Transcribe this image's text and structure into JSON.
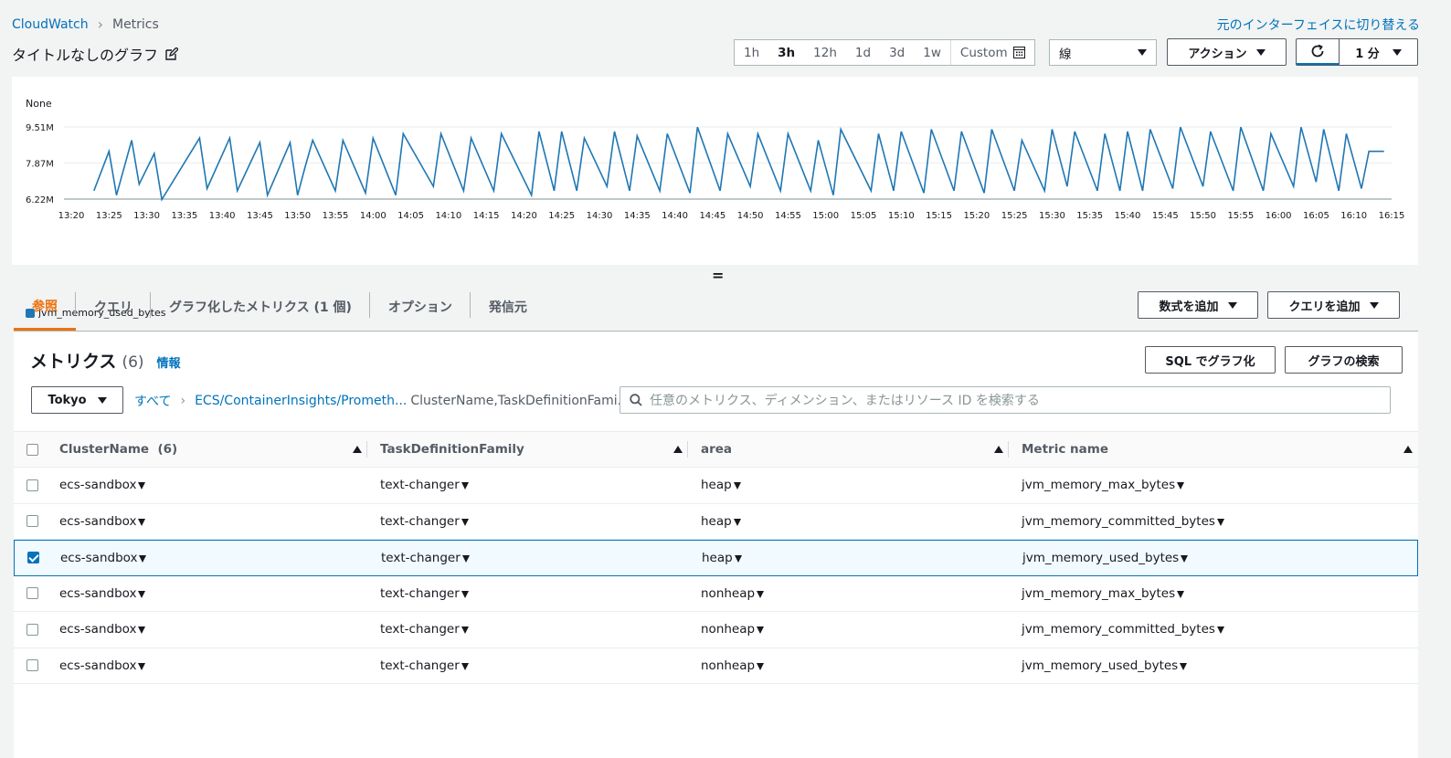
{
  "breadcrumb": {
    "root": "CloudWatch",
    "current": "Metrics"
  },
  "classic_link": "元のインターフェイスに切り替える",
  "graph_title": "タイトルなしのグラフ",
  "time_range": {
    "options": [
      "1h",
      "3h",
      "12h",
      "1d",
      "3d",
      "1w"
    ],
    "selected": "3h",
    "custom_label": "Custom"
  },
  "chart_type": "線",
  "actions_label": "アクション",
  "refresh_interval": "1 分",
  "tabs": [
    "参照",
    "クエリ",
    "グラフ化したメトリクス (1 個)",
    "オプション",
    "発信元"
  ],
  "active_tab": "参照",
  "add_math_label": "数式を追加",
  "add_query_label": "クエリを追加",
  "metrics": {
    "title": "メトリクス",
    "count": "(6)",
    "info": "情報",
    "sql_label": "SQL でグラフ化",
    "search_graph_label": "グラフの検索",
    "region": "Tokyo",
    "crumb_all": "すべて",
    "crumb_namespace": "ECS/ContainerInsights/Prometh...",
    "crumb_dimensions": "ClusterName,TaskDefinitionFami...",
    "search_placeholder": "任意のメトリクス、ディメンション、またはリソース ID を検索する"
  },
  "table": {
    "headers": [
      "ClusterName  (6)",
      "TaskDefinitionFamily",
      "area",
      "Metric name"
    ],
    "rows": [
      {
        "cluster": "ecs-sandbox",
        "task": "text-changer",
        "area": "heap",
        "metric": "jvm_memory_max_bytes",
        "checked": false
      },
      {
        "cluster": "ecs-sandbox",
        "task": "text-changer",
        "area": "heap",
        "metric": "jvm_memory_committed_bytes",
        "checked": false
      },
      {
        "cluster": "ecs-sandbox",
        "task": "text-changer",
        "area": "heap",
        "metric": "jvm_memory_used_bytes",
        "checked": true
      },
      {
        "cluster": "ecs-sandbox",
        "task": "text-changer",
        "area": "nonheap",
        "metric": "jvm_memory_max_bytes",
        "checked": false
      },
      {
        "cluster": "ecs-sandbox",
        "task": "text-changer",
        "area": "nonheap",
        "metric": "jvm_memory_committed_bytes",
        "checked": false
      },
      {
        "cluster": "ecs-sandbox",
        "task": "text-changer",
        "area": "nonheap",
        "metric": "jvm_memory_used_bytes",
        "checked": false
      }
    ]
  },
  "colors": {
    "series": "#1f77b4",
    "accent": "#ec7211",
    "link": "#0073bb"
  },
  "chart_data": {
    "type": "line",
    "ylabel": "None",
    "y_ticks": [
      "6.22M",
      "7.87M",
      "9.51M"
    ],
    "y_tick_values": [
      6.22,
      7.87,
      9.51
    ],
    "x_ticks": [
      "13:20",
      "13:25",
      "13:30",
      "13:35",
      "13:40",
      "13:45",
      "13:50",
      "13:55",
      "14:00",
      "14:05",
      "14:10",
      "14:15",
      "14:20",
      "14:25",
      "14:30",
      "14:35",
      "14:40",
      "14:45",
      "14:50",
      "14:55",
      "15:00",
      "15:05",
      "15:10",
      "15:15",
      "15:20",
      "15:25",
      "15:30",
      "15:35",
      "15:40",
      "15:45",
      "15:50",
      "15:55",
      "16:00",
      "16:05",
      "16:10",
      "16:15"
    ],
    "series": [
      {
        "name": "jvm_memory_used_bytes",
        "x": [
          "13:23",
          "13:25",
          "13:26",
          "13:28",
          "13:29",
          "13:31",
          "13:32",
          "13:37",
          "13:38",
          "13:41",
          "13:42",
          "13:45",
          "13:46",
          "13:49",
          "13:50",
          "13:51",
          "13:52",
          "13:55",
          "13:56",
          "13:59",
          "14:00",
          "14:03",
          "14:04",
          "14:08",
          "14:09",
          "14:12",
          "14:13",
          "14:16",
          "14:17",
          "14:21",
          "14:22",
          "14:24",
          "14:25",
          "14:27",
          "14:28",
          "14:31",
          "14:32",
          "14:34",
          "14:35",
          "14:38",
          "14:39",
          "14:42",
          "14:43",
          "14:46",
          "14:47",
          "14:50",
          "14:51",
          "14:54",
          "14:55",
          "14:58",
          "14:59",
          "15:01",
          "15:02",
          "15:06",
          "15:07",
          "15:09",
          "15:10",
          "15:13",
          "15:14",
          "15:17",
          "15:18",
          "15:21",
          "15:22",
          "15:25",
          "15:26",
          "15:29",
          "15:30",
          "15:32",
          "15:33",
          "15:36",
          "15:37",
          "15:39",
          "15:40",
          "15:42",
          "15:43",
          "15:46",
          "15:47",
          "15:50",
          "15:51",
          "15:54",
          "15:55",
          "15:58",
          "15:59",
          "16:02",
          "16:03",
          "16:05",
          "16:06",
          "16:08",
          "16:09",
          "16:11",
          "16:12",
          "16:14"
        ],
        "values": [
          6.6,
          8.4,
          6.4,
          8.9,
          6.9,
          8.3,
          6.2,
          9.0,
          6.7,
          9.0,
          6.6,
          8.8,
          6.4,
          8.8,
          6.4,
          7.7,
          8.9,
          6.6,
          8.9,
          6.5,
          9.0,
          6.4,
          9.2,
          6.8,
          9.2,
          6.6,
          9.0,
          6.6,
          9.2,
          6.4,
          9.3,
          6.6,
          9.3,
          6.6,
          9.0,
          6.8,
          9.3,
          6.6,
          9.1,
          6.6,
          9.2,
          6.5,
          9.5,
          6.6,
          9.2,
          6.8,
          9.2,
          6.6,
          9.2,
          6.6,
          8.9,
          6.4,
          9.4,
          6.6,
          9.2,
          6.6,
          9.3,
          6.5,
          9.4,
          6.6,
          9.3,
          6.5,
          9.4,
          6.6,
          8.9,
          6.6,
          9.4,
          6.8,
          9.3,
          6.6,
          9.2,
          6.6,
          9.3,
          6.6,
          9.4,
          6.7,
          9.5,
          6.8,
          9.3,
          6.6,
          9.5,
          6.6,
          9.2,
          6.8,
          9.5,
          7.0,
          9.4,
          6.6,
          9.2,
          6.7,
          8.4,
          8.4
        ]
      }
    ]
  }
}
